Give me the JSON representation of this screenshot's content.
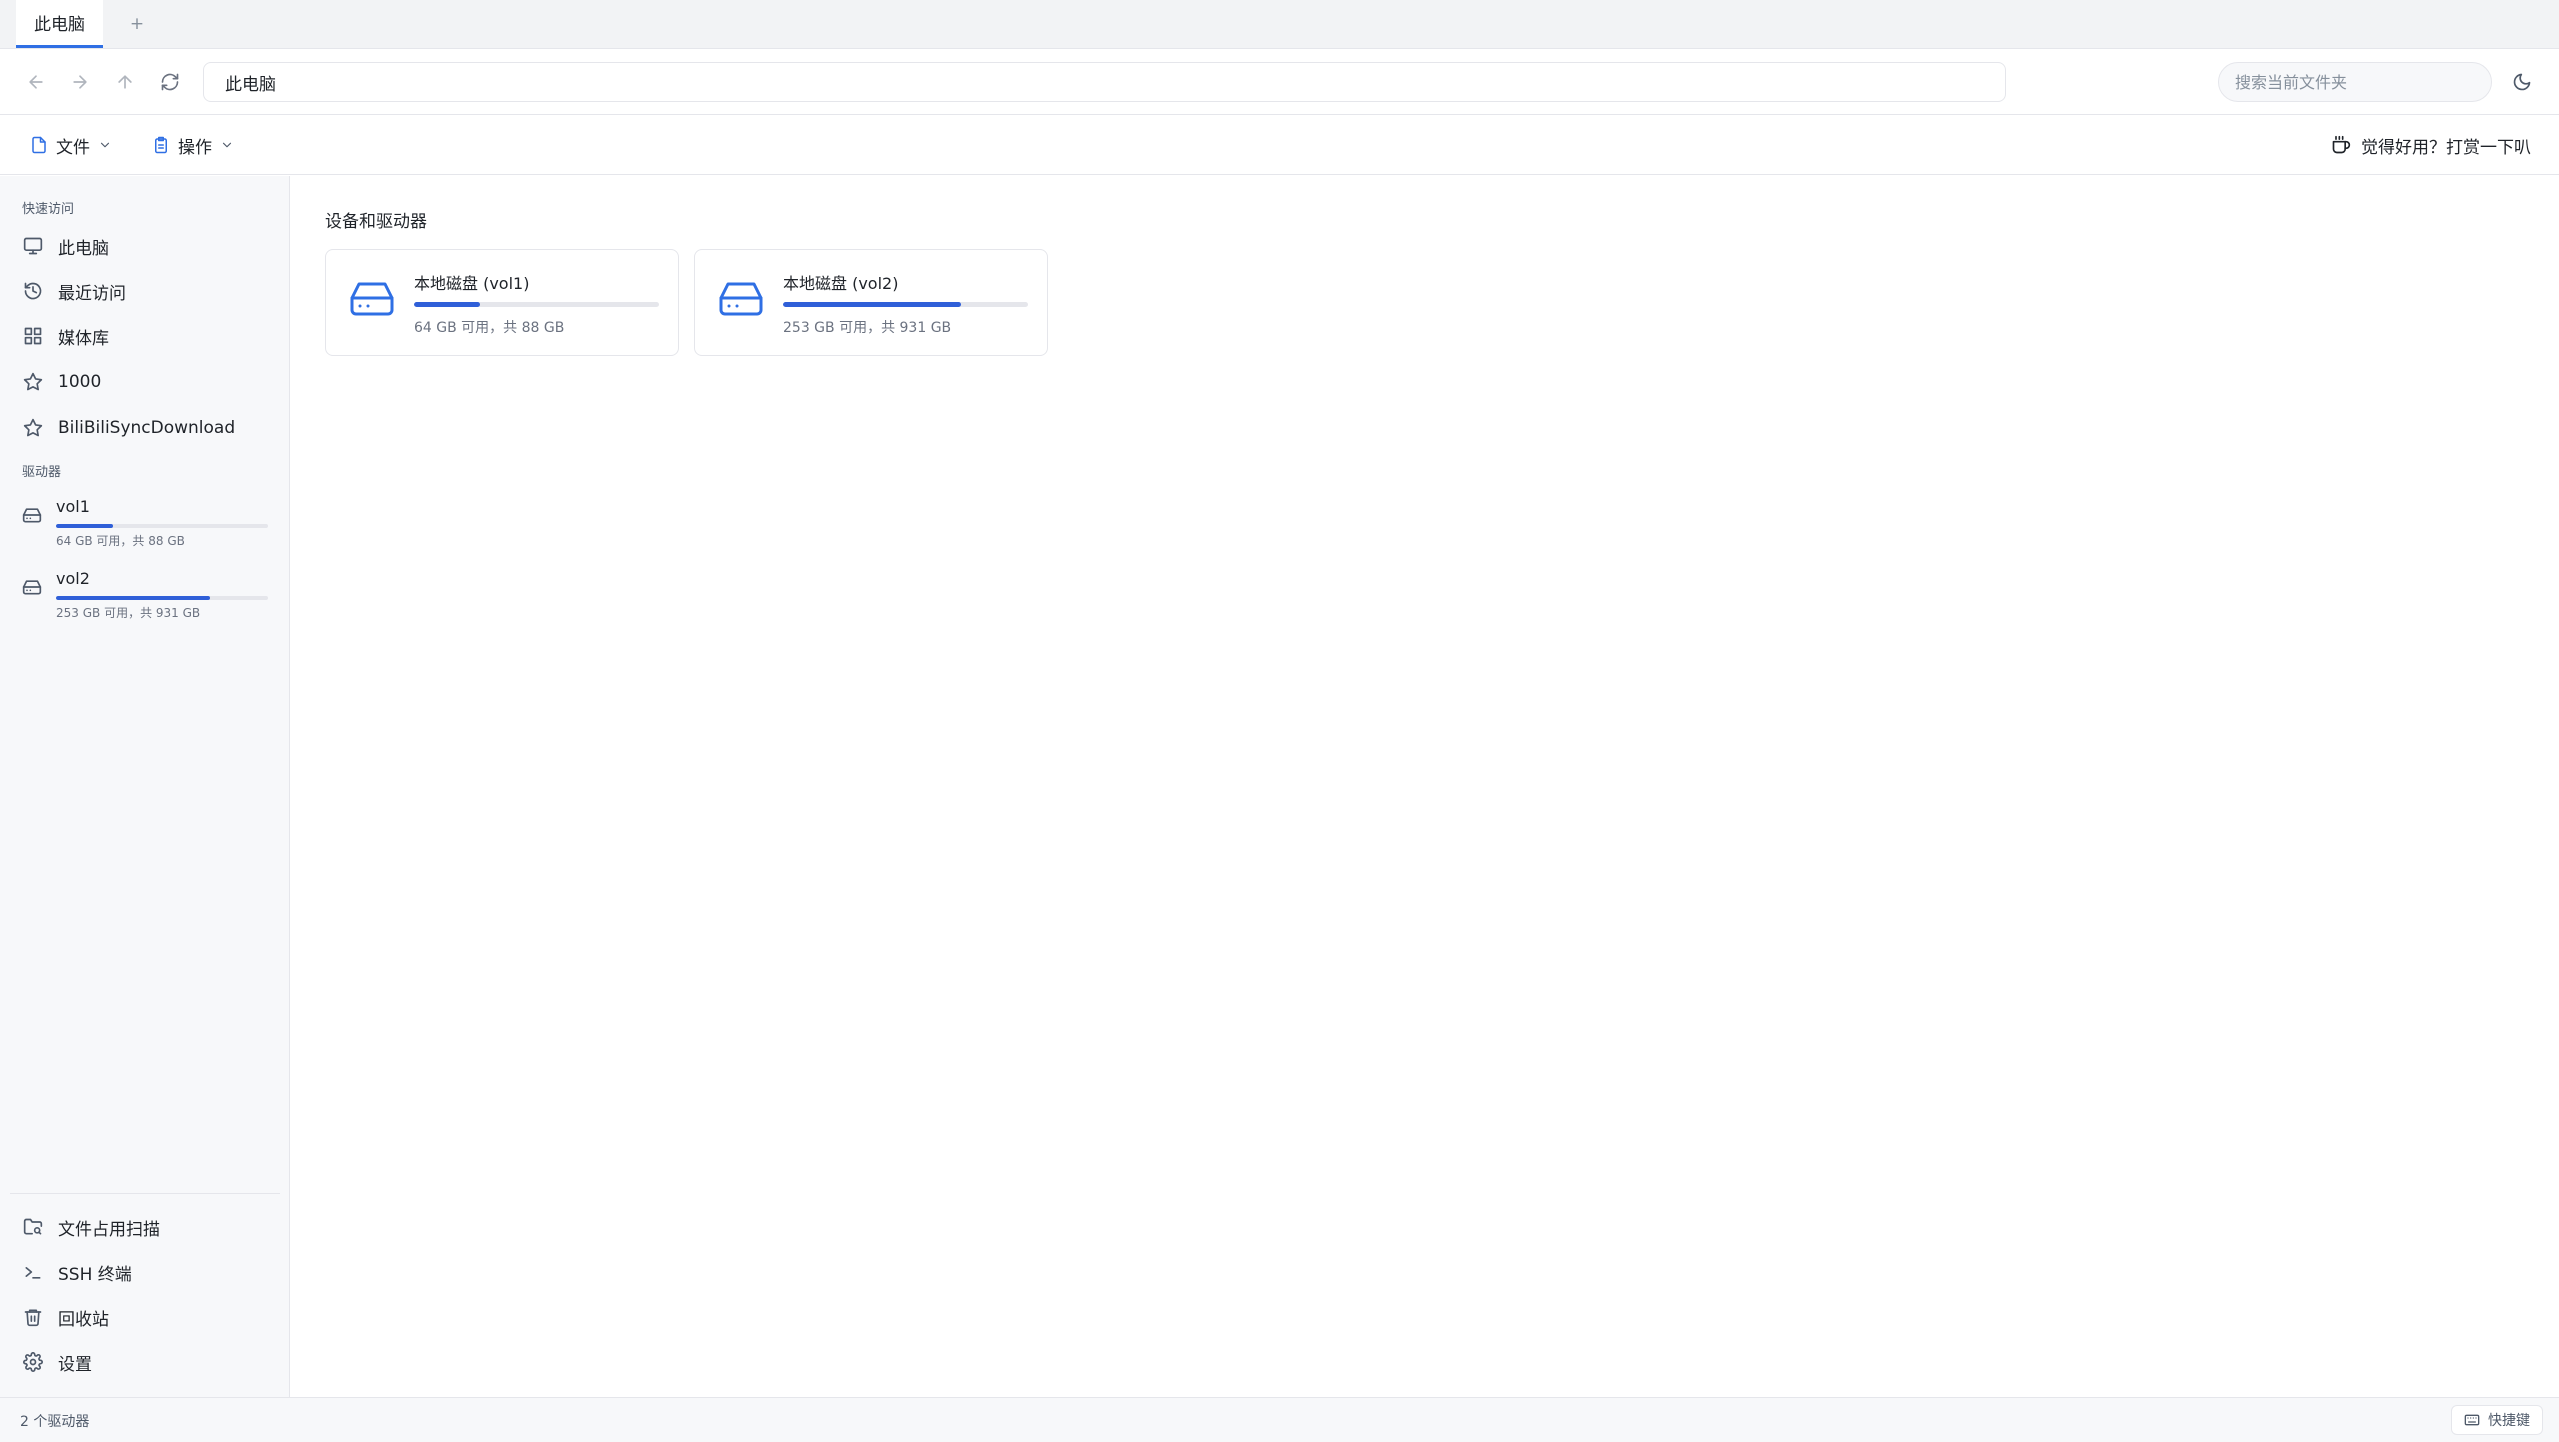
{
  "tabs": [
    {
      "label": "此电脑"
    }
  ],
  "tab_add_label": "+",
  "address": {
    "path": "此电脑"
  },
  "search": {
    "placeholder": "搜索当前文件夹"
  },
  "toolbar": {
    "file_label": "文件",
    "ops_label": "操作",
    "donate_label": "觉得好用？打赏一下叭"
  },
  "sidebar": {
    "quick_access_label": "快速访问",
    "quick_items": [
      {
        "label": "此电脑",
        "icon": "monitor-icon"
      },
      {
        "label": "最近访问",
        "icon": "history-icon"
      },
      {
        "label": "媒体库",
        "icon": "grid-icon"
      },
      {
        "label": "1000",
        "icon": "star-icon"
      },
      {
        "label": "BiliBiliSyncDownload",
        "icon": "star-icon"
      }
    ],
    "drives_label": "驱动器",
    "drives": [
      {
        "name": "vol1",
        "info": "64 GB 可用，共 88 GB",
        "used_fraction": 0.27
      },
      {
        "name": "vol2",
        "info": "253 GB 可用，共 931 GB",
        "used_fraction": 0.728
      }
    ],
    "bottom_items": [
      {
        "label": "文件占用扫描",
        "icon": "folder-search-icon"
      },
      {
        "label": "SSH 终端",
        "icon": "terminal-icon"
      },
      {
        "label": "回收站",
        "icon": "trash-icon"
      },
      {
        "label": "设置",
        "icon": "gear-icon"
      }
    ]
  },
  "main": {
    "section_title": "设备和驱动器",
    "drives": [
      {
        "name": "本地磁盘 (vol1)",
        "info": "64 GB 可用，共 88 GB",
        "used_fraction": 0.27
      },
      {
        "name": "本地磁盘 (vol2)",
        "info": "253 GB 可用，共 931 GB",
        "used_fraction": 0.728
      }
    ]
  },
  "status": {
    "left_text": "2 个驱动器",
    "shortcut_label": "快捷键"
  },
  "colors": {
    "accent": "#2f6fe4",
    "bar_fill": "#2f5fd8",
    "bar_track": "#e5e6eb"
  }
}
